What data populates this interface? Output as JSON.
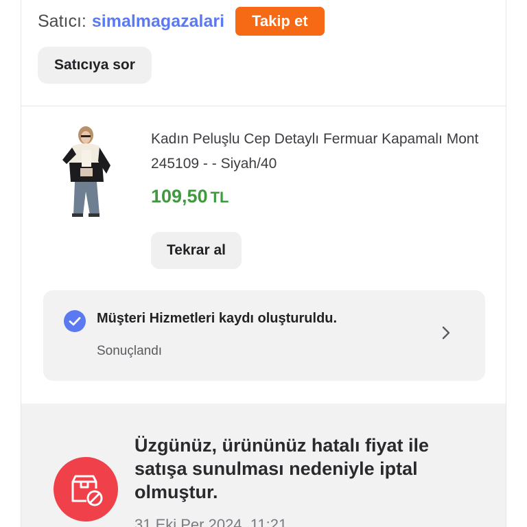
{
  "seller": {
    "prefix": "Satıcı:",
    "name": "simalmagazalari",
    "follow_label": "Takip et",
    "ask_label": "Satıcıya sor"
  },
  "product": {
    "title": "Kadın Peluşlu Cep Detaylı Fermuar Kapamalı Mont 245109 - - Siyah/40",
    "price": "109,50",
    "currency": "TL",
    "reorder_label": "Tekrar al",
    "image_icon": "product-thumbnail"
  },
  "support": {
    "title": "Müşteri Hizmetleri kaydı oluşturuldu.",
    "status": "Sonuçlandı",
    "icon": "check-circle-icon",
    "chevron": "chevron-right-icon"
  },
  "notice": {
    "message": "Üzgünüz, ürününüz hatalı fiyat ile satışa sunulması nedeniyle iptal olmuştur.",
    "date": "31 Eki Per 2024, 11:21",
    "icon": "cancelled-package-icon"
  },
  "colors": {
    "accent_orange": "#f66a16",
    "seller_blue": "#5b79f0",
    "price_green": "#3f9a3f",
    "cancel_red": "#f0404a",
    "check_blue": "#5b79f0"
  }
}
